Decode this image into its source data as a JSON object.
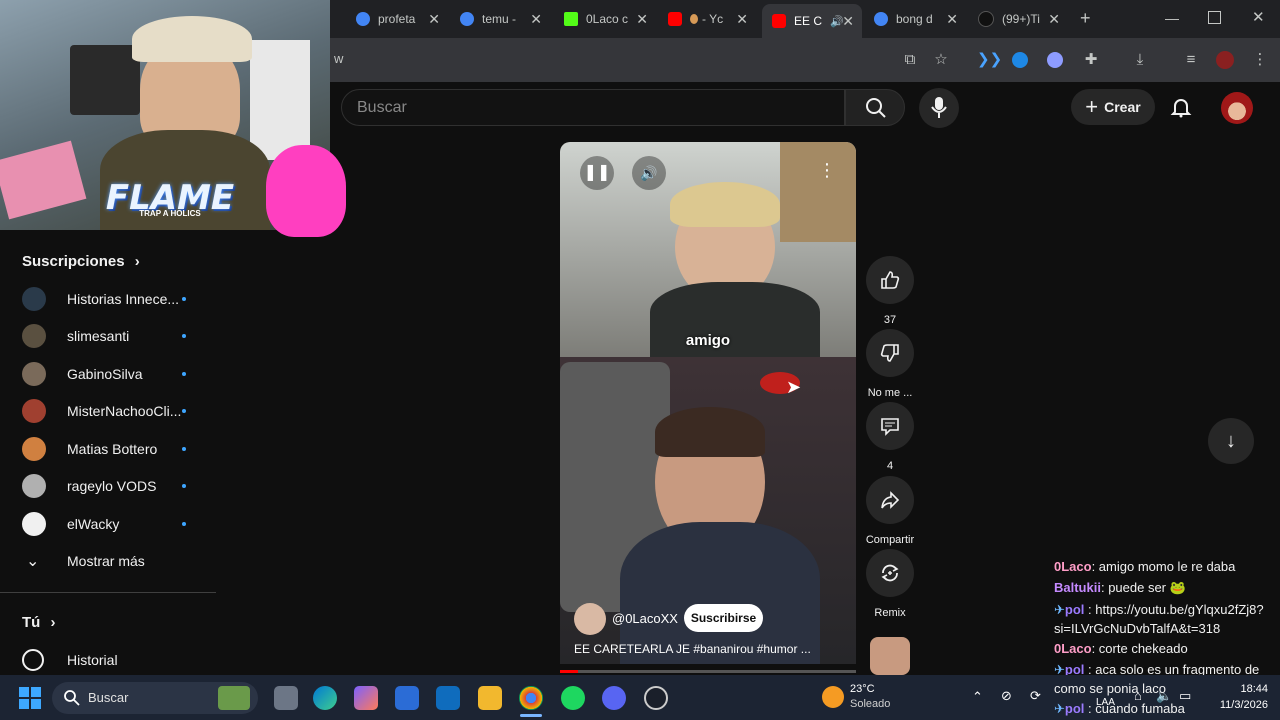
{
  "browser": {
    "tabs": [
      {
        "label": "profeta",
        "fav": "#4285f4"
      },
      {
        "label": "temu -",
        "fav": "#4285f4"
      },
      {
        "label": "0Laco c",
        "fav": "#53fc18"
      },
      {
        "label": "- Yc",
        "fav": "#ff0000"
      },
      {
        "label": "EE C",
        "fav": "#ff0000"
      },
      {
        "label": "bong d",
        "fav": "#4285f4"
      },
      {
        "label": "(99+)Ti",
        "fav": "#111111"
      }
    ],
    "new_tab": "+",
    "address": "w"
  },
  "header": {
    "search_placeholder": "Buscar",
    "create_label": "Crear"
  },
  "sidebar": {
    "subscriptions_title": "Suscripciones",
    "channels": [
      {
        "name": "Historias Innece...",
        "color": "#2a3a4a"
      },
      {
        "name": "slimesanti",
        "color": "#5a5040"
      },
      {
        "name": "GabinoSilva",
        "color": "#7a6a5a"
      },
      {
        "name": "MisterNachooCli...",
        "color": "#a04030"
      },
      {
        "name": "Matias Bottero",
        "color": "#d08040"
      },
      {
        "name": "rageylo VODS",
        "color": "#b0b0b0"
      },
      {
        "name": "elWacky",
        "color": "#f0f0f0"
      }
    ],
    "show_more": "Mostrar más",
    "you_title": "Tú",
    "history": "Historial"
  },
  "overlay": {
    "logo_text": "FLAME",
    "logo_sub": "TRAP A HOLICS"
  },
  "short": {
    "caption": "amigo",
    "channel": "@0LacoXX",
    "subscribe": "Suscribirse",
    "title": "EE CARETEARLA JE  #bananirou #humor ..."
  },
  "actions": {
    "likes": "37",
    "dislike": "No me ...",
    "comments": "4",
    "share": "Compartir",
    "remix": "Remix"
  },
  "chat": [
    {
      "user": "0Laco",
      "color": "#ff9ec8",
      "text": ": amigo momo le re daba"
    },
    {
      "user": "Baltukii",
      "color": "#c58aff",
      "text": ": puede ser 🐸"
    },
    {
      "user": "pol",
      "color": "#9b7bff",
      "text": " : https://youtu.be/gYlqxu2fZj8?"
    },
    {
      "user": "",
      "color": "#f1f1f1",
      "text": "si=ILVrGcNuDvbTalfA&t=318"
    },
    {
      "user": "0Laco",
      "color": "#ff9ec8",
      "text": ": corte chekeado"
    },
    {
      "user": "pol",
      "color": "#9b7bff",
      "text": " : aca solo es un fragmento de"
    },
    {
      "user": "",
      "color": "#f1f1f1",
      "text": "como se ponia laco"
    },
    {
      "user": "pol",
      "color": "#9b7bff",
      "text": " : cuando fumaba"
    }
  ],
  "taskbar": {
    "search": "Buscar",
    "weather_temp": "23°C",
    "weather_desc": "Soleado",
    "lang": "LAA",
    "time": "18:44",
    "date": "11/3/2026"
  }
}
